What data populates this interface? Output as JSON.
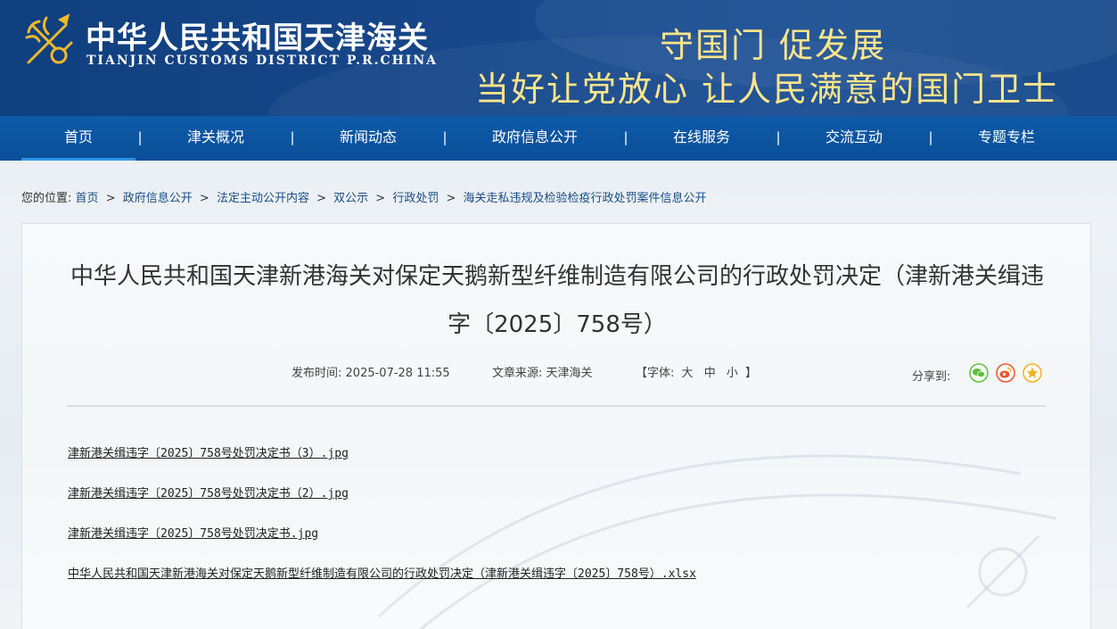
{
  "header": {
    "title": "中华人民共和国天津海关",
    "subtitle": "TIANJIN CUSTOMS DISTRICT P.R.CHINA",
    "slogan_line1": "守国门  促发展",
    "slogan_line2": "当好让党放心  让人民满意的国门卫士",
    "emblem_icon": "customs-emblem-icon"
  },
  "nav": {
    "items": [
      {
        "label": "首页",
        "active": true
      },
      {
        "label": "津关概况"
      },
      {
        "label": "新闻动态"
      },
      {
        "label": "政府信息公开"
      },
      {
        "label": "在线服务"
      },
      {
        "label": "交流互动"
      },
      {
        "label": "专题专栏"
      }
    ],
    "separator": "|"
  },
  "breadcrumb": {
    "prefix": "您的位置:",
    "items": [
      "首页",
      "政府信息公开",
      "法定主动公开内容",
      "双公示",
      "行政处罚",
      "海关走私违规及检验检疫行政处罚案件信息公开"
    ],
    "separator": ">"
  },
  "article": {
    "title": "中华人民共和国天津新港海关对保定天鹅新型纤维制造有限公司的行政处罚决定（津新港关缉违字〔2025〕758号）",
    "publish_label": "发布时间:",
    "publish_time": "2025-07-28 11:55",
    "source_label": "文章来源:",
    "source": "天津海关",
    "font_size_open": "【字体:",
    "font_large": "大",
    "font_medium": "中",
    "font_small": "小",
    "font_size_close": "】",
    "share_label": "分享到:",
    "share_icons": [
      "wechat-icon",
      "weibo-icon",
      "favorite-icon"
    ],
    "attachments": [
      "津新港关缉违字〔2025〕758号处罚决定书（3）.jpg",
      "津新港关缉违字〔2025〕758号处罚决定书（2）.jpg",
      "津新港关缉违字〔2025〕758号处罚决定书.jpg",
      "中华人民共和国天津新港海关对保定天鹅新型纤维制造有限公司的行政处罚决定（津新港关缉违字〔2025〕758号）.xlsx"
    ]
  },
  "colors": {
    "header_bg": "#17478a",
    "nav_bg": "#0e5aa8",
    "slogan": "#ffe58a",
    "link": "#1a4d86",
    "wechat": "#5bbf3a",
    "weibo": "#e8542d",
    "favorite": "#f2b01e"
  }
}
